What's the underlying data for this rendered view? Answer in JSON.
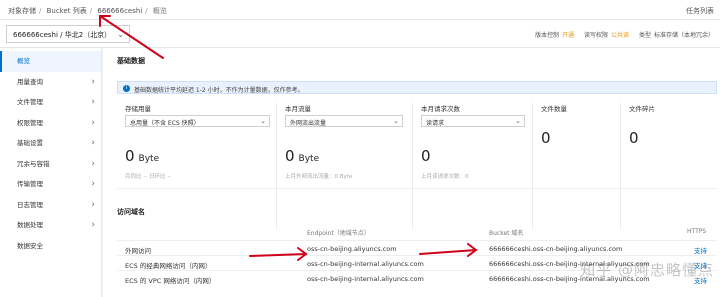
{
  "breadcrumb": [
    "对象存储",
    "Bucket 列表",
    "666666ceshi",
    "概览"
  ],
  "task_list": "任务列表",
  "bucket": {
    "name": "666666ceshi / 华北2（北京）"
  },
  "bucket_meta": {
    "version_label": "版本控制",
    "version_status": "开通",
    "acl_label": "读写权限",
    "acl_status": "公共读",
    "type_label": "类型",
    "type_value": "标准存储（本地冗余）"
  },
  "sidebar": {
    "items": [
      {
        "label": "概览",
        "arrow": false
      },
      {
        "label": "用量查询",
        "arrow": true
      },
      {
        "label": "文件管理",
        "arrow": true
      },
      {
        "label": "权限管理",
        "arrow": true
      },
      {
        "label": "基础设置",
        "arrow": true
      },
      {
        "label": "冗余与容错",
        "arrow": true
      },
      {
        "label": "传输管理",
        "arrow": true
      },
      {
        "label": "日志管理",
        "arrow": true
      },
      {
        "label": "数据处理",
        "arrow": true
      },
      {
        "label": "数据安全",
        "arrow": false
      }
    ]
  },
  "basic": {
    "title": "基础数据",
    "notice": "基础数据统计平均延迟 1-2 小时，不作为计量数据，仅作参考。",
    "cards": [
      {
        "title": "存储用量",
        "select": "总用量（不含 ECS 快照）",
        "value": "0",
        "unit": "Byte",
        "sub": "月同比 -- 日环比 --"
      },
      {
        "title": "本月流量",
        "select": "外网流出流量",
        "value": "0",
        "unit": "Byte",
        "sub": "上月外网流出流量：0 Byte"
      },
      {
        "title": "本月请求次数",
        "select": "读请求",
        "value": "0",
        "unit": "",
        "sub": "上月读请求次数：0"
      },
      {
        "title": "文件数量",
        "select": "",
        "value": "0",
        "unit": "",
        "sub": ""
      },
      {
        "title": "文件碎片",
        "select": "",
        "value": "0",
        "unit": "",
        "sub": ""
      }
    ]
  },
  "access": {
    "title": "访问域名",
    "headers": {
      "endpoint": "Endpoint（地域节点）",
      "bucket_domain": "Bucket 域名",
      "https": "HTTPS"
    },
    "rows": [
      {
        "name": "外网访问",
        "endpoint": "oss-cn-beijing.aliyuncs.com",
        "domain": "666666ceshi.oss-cn-beijing.aliyuncs.com",
        "https": "支持"
      },
      {
        "name": "ECS 的经典网络访问（内网）",
        "endpoint": "oss-cn-beijing-internal.aliyuncs.com",
        "domain": "666666ceshi.oss-cn-beijing-internal.aliyuncs.com",
        "https": "支持"
      },
      {
        "name": "ECS 的 VPC 网络访问（内网）",
        "endpoint": "oss-cn-beijing-internal.aliyuncs.com",
        "domain": "666666ceshi.oss-cn-beijing-internal.aliyuncs.com",
        "https": "支持"
      }
    ]
  },
  "watermark": "知乎 @阿忠略懂点",
  "colors": {
    "accent": "#0070cc",
    "annotation": "#d0021b"
  }
}
